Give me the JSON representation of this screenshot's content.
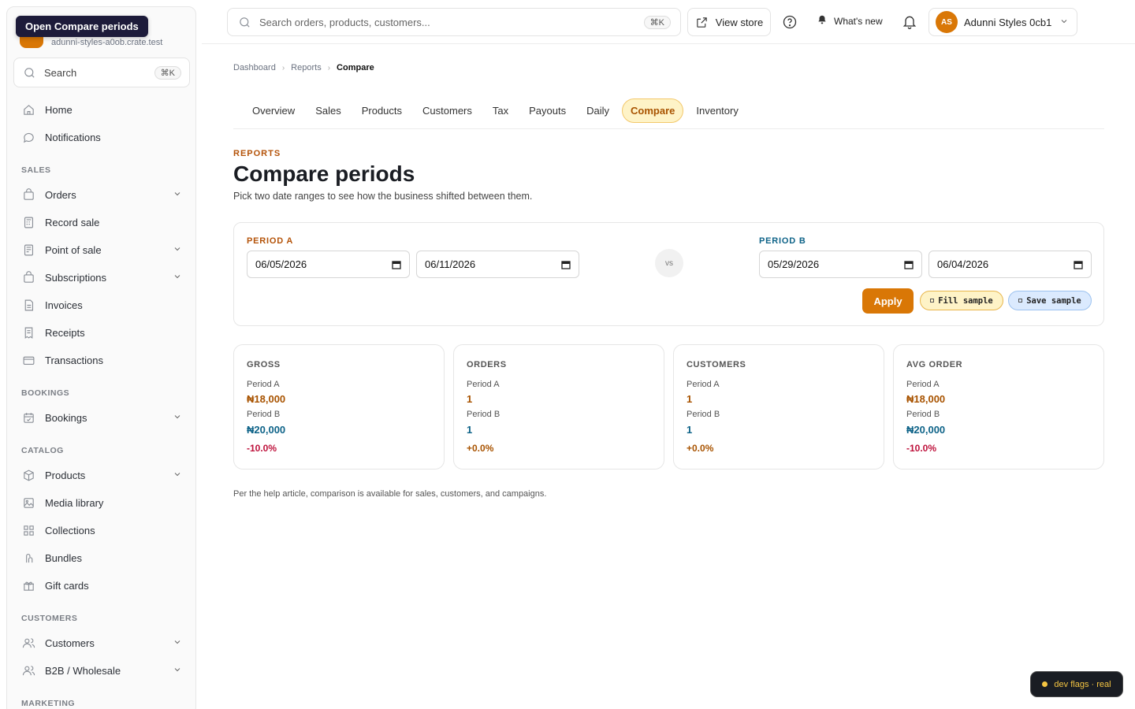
{
  "tooltip": "Open Compare periods",
  "sidebar": {
    "store_domain": "adunni-styles-a0ob.crate.test",
    "search_label": "Search",
    "search_kbd": "⌘K",
    "items_top": [
      {
        "label": "Home",
        "icon": "home-icon"
      },
      {
        "label": "Notifications",
        "icon": "chat-icon"
      }
    ],
    "section_sales": "SALES",
    "sales_items": [
      {
        "label": "Orders",
        "icon": "bag-icon",
        "expandable": true
      },
      {
        "label": "Record sale",
        "icon": "calculator-icon",
        "expandable": false
      },
      {
        "label": "Point of sale",
        "icon": "terminal-icon",
        "expandable": true
      },
      {
        "label": "Subscriptions",
        "icon": "bag-icon",
        "expandable": true
      },
      {
        "label": "Invoices",
        "icon": "document-icon",
        "expandable": false
      },
      {
        "label": "Receipts",
        "icon": "receipt-icon",
        "expandable": false
      },
      {
        "label": "Transactions",
        "icon": "card-icon",
        "expandable": false
      }
    ],
    "section_bookings": "BOOKINGS",
    "bookings_items": [
      {
        "label": "Bookings",
        "icon": "calendar-icon",
        "expandable": true
      }
    ],
    "section_catalog": "CATALOG",
    "catalog_items": [
      {
        "label": "Products",
        "icon": "box-icon",
        "expandable": true
      },
      {
        "label": "Media library",
        "icon": "image-icon",
        "expandable": false
      },
      {
        "label": "Collections",
        "icon": "grid-icon",
        "expandable": false
      },
      {
        "label": "Bundles",
        "icon": "bundle-icon",
        "expandable": false
      },
      {
        "label": "Gift cards",
        "icon": "gift-icon",
        "expandable": false
      }
    ],
    "section_customers": "CUSTOMERS",
    "customers_items": [
      {
        "label": "Customers",
        "icon": "users-icon",
        "expandable": true
      },
      {
        "label": "B2B / Wholesale",
        "icon": "users-icon",
        "expandable": true
      }
    ],
    "section_marketing": "MARKETING"
  },
  "topbar": {
    "search_placeholder": "Search orders, products, customers...",
    "search_kbd": "⌘K",
    "view_store": "View store",
    "whats_new": "What's new",
    "account_initials": "AS",
    "account_name": "Adunni Styles 0cb1"
  },
  "breadcrumb": [
    "Dashboard",
    "Reports",
    "Compare"
  ],
  "tabs": [
    "Overview",
    "Sales",
    "Products",
    "Customers",
    "Tax",
    "Payouts",
    "Daily",
    "Compare",
    "Inventory"
  ],
  "active_tab": "Compare",
  "page": {
    "eyebrow": "REPORTS",
    "title": "Compare periods",
    "subtitle": "Pick two date ranges to see how the business shifted between them."
  },
  "periods": {
    "a_label": "PERIOD A",
    "a_start": "06/05/2026",
    "a_end": "06/11/2026",
    "vs": "vs",
    "b_label": "PERIOD B",
    "b_start": "05/29/2026",
    "b_end": "06/04/2026",
    "apply": "Apply",
    "fill_sample": "Fill sample",
    "save_sample": "Save sample"
  },
  "metrics": [
    {
      "title": "GROSS",
      "label_a": "Period A",
      "value_a": "₦18,000",
      "label_b": "Period B",
      "value_b": "₦20,000",
      "delta": "-10.0%",
      "trend": "neg"
    },
    {
      "title": "ORDERS",
      "label_a": "Period A",
      "value_a": "1",
      "label_b": "Period B",
      "value_b": "1",
      "delta": "+0.0%",
      "trend": "pos"
    },
    {
      "title": "CUSTOMERS",
      "label_a": "Period A",
      "value_a": "1",
      "label_b": "Period B",
      "value_b": "1",
      "delta": "+0.0%",
      "trend": "pos"
    },
    {
      "title": "AVG ORDER",
      "label_a": "Period A",
      "value_a": "₦18,000",
      "label_b": "Period B",
      "value_b": "₦20,000",
      "delta": "-10.0%",
      "trend": "neg"
    }
  ],
  "footnote": "Per the help article, comparison is available for sales, customers, and campaigns.",
  "dev_flags": "dev flags · real",
  "colors": {
    "accent": "#d97706",
    "period_a": "#b45309",
    "period_b": "#0e6388",
    "negative": "#be123c"
  }
}
